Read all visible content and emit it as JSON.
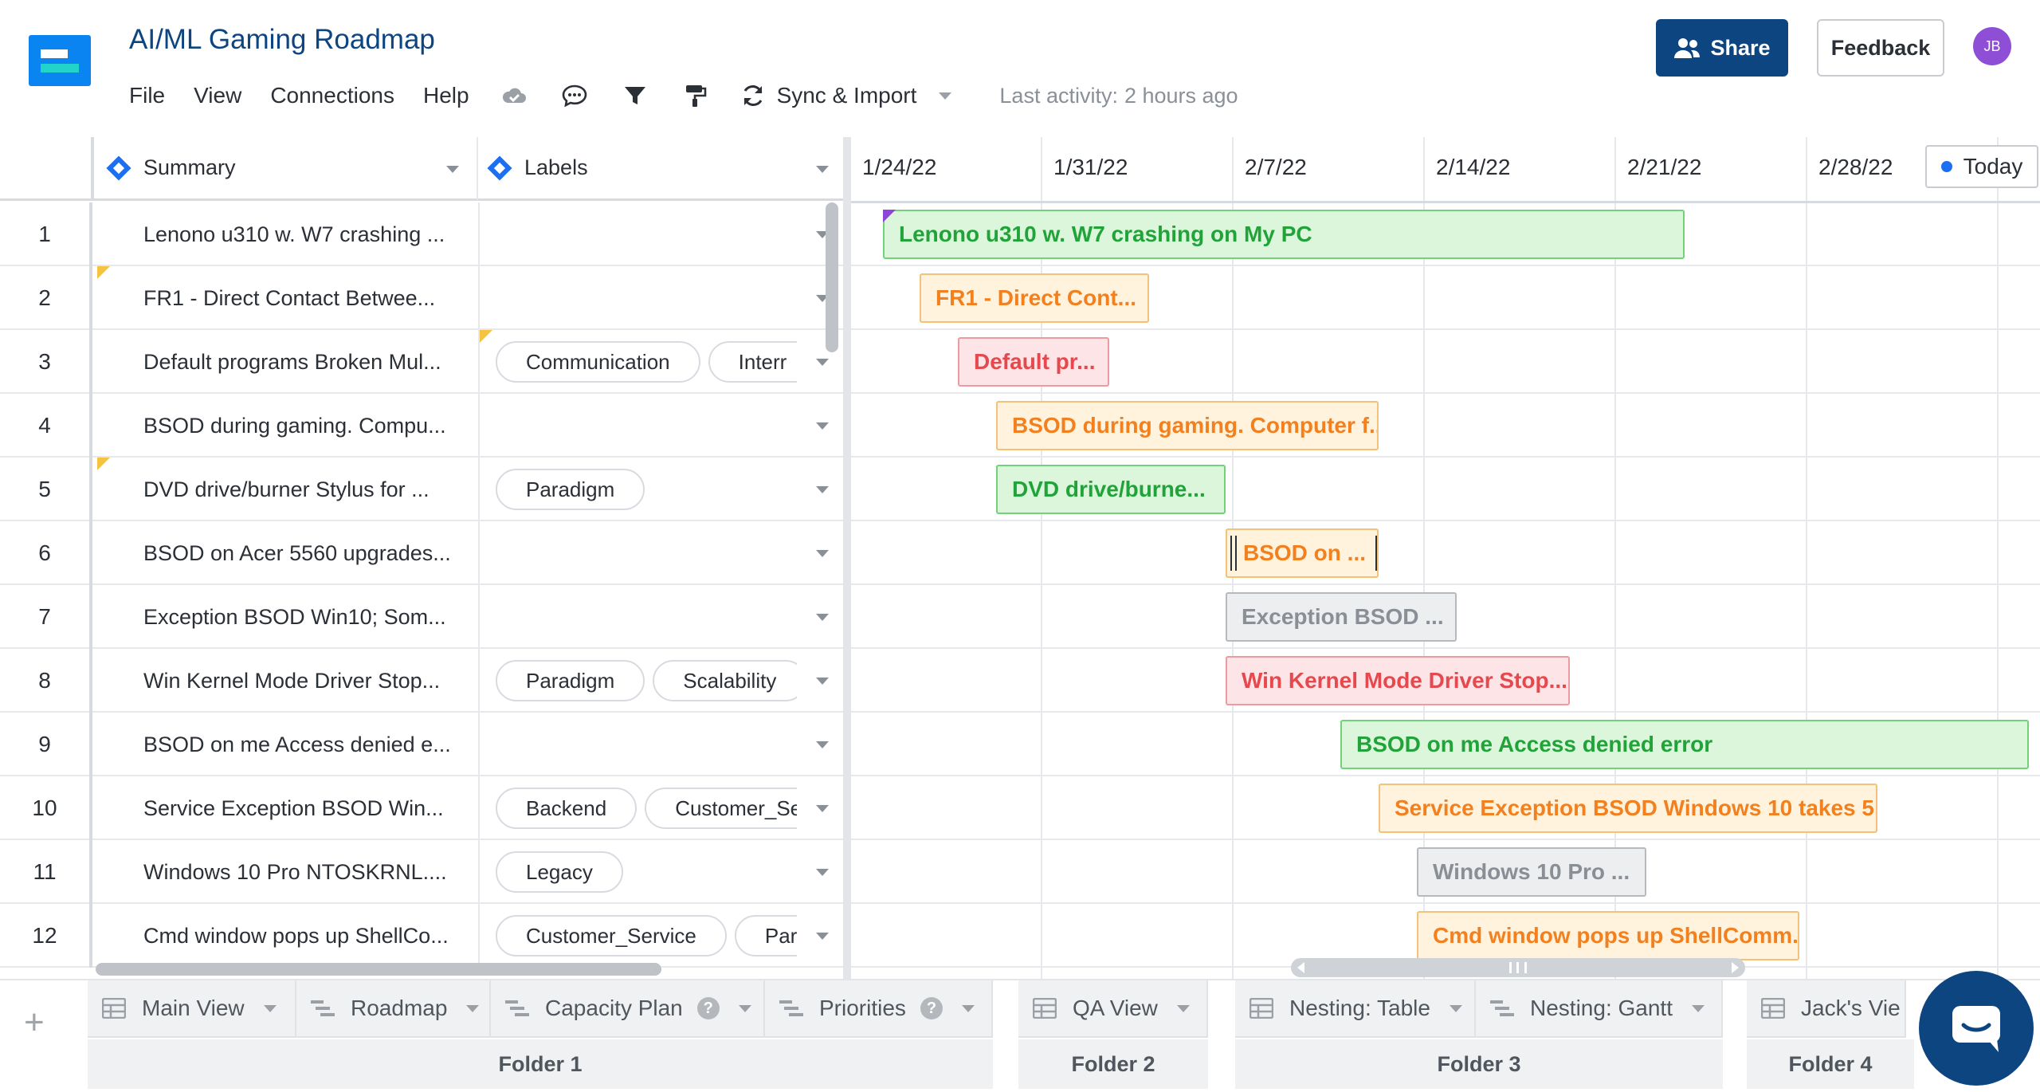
{
  "app": {
    "title": "AI/ML Gaming Roadmap",
    "menu": [
      "File",
      "View",
      "Connections",
      "Help"
    ],
    "sync_label": "Sync & Import",
    "last_activity_label": "Last activity:",
    "last_activity_value": "2 hours ago",
    "share_label": "Share",
    "feedback_label": "Feedback",
    "avatar_initials": "JB"
  },
  "grid": {
    "columns": {
      "summary": "Summary",
      "labels": "Labels"
    },
    "rows": [
      {
        "num": "1",
        "summary": "Lenono u310 w. W7 crashing ...",
        "labels": []
      },
      {
        "num": "2",
        "summary": "FR1 - Direct Contact Betwee...",
        "labels": []
      },
      {
        "num": "3",
        "summary": "Default programs Broken Mul...",
        "labels": [
          "Communication",
          "Interr"
        ]
      },
      {
        "num": "4",
        "summary": "BSOD during gaming. Compu...",
        "labels": []
      },
      {
        "num": "5",
        "summary": "DVD drive/burner Stylus for ...",
        "labels": [
          "Paradigm"
        ]
      },
      {
        "num": "6",
        "summary": "BSOD on Acer 5560 upgrades...",
        "labels": []
      },
      {
        "num": "7",
        "summary": "Exception BSOD Win10; Som...",
        "labels": []
      },
      {
        "num": "8",
        "summary": "Win Kernel Mode Driver Stop...",
        "labels": [
          "Paradigm",
          "Scalability"
        ]
      },
      {
        "num": "9",
        "summary": "BSOD on me Access denied e...",
        "labels": []
      },
      {
        "num": "10",
        "summary": "Service Exception BSOD Win...",
        "labels": [
          "Backend",
          "Customer_Se"
        ]
      },
      {
        "num": "11",
        "summary": "Windows 10 Pro NTOSKRNL....",
        "labels": [
          "Legacy"
        ]
      },
      {
        "num": "12",
        "summary": "Cmd window pops up ShellCo...",
        "labels": [
          "Customer_Service",
          "Par"
        ]
      }
    ]
  },
  "gantt": {
    "weeks": [
      "1/24/22",
      "1/31/22",
      "2/7/22",
      "2/14/22",
      "2/21/22",
      "2/28/22"
    ],
    "today_label": "Today",
    "bars": [
      {
        "row": 1,
        "label": "Lenono u310 w. W7 crashing on My PC",
        "color": "green"
      },
      {
        "row": 2,
        "label": "FR1 - Direct Cont...",
        "color": "orange"
      },
      {
        "row": 3,
        "label": "Default pr...",
        "color": "red"
      },
      {
        "row": 4,
        "label": "BSOD during gaming. Computer f...",
        "color": "orange"
      },
      {
        "row": 5,
        "label": "DVD drive/burne...",
        "color": "green"
      },
      {
        "row": 6,
        "label": "BSOD on ...",
        "color": "orange"
      },
      {
        "row": 7,
        "label": "Exception BSOD ...",
        "color": "gray"
      },
      {
        "row": 8,
        "label": "Win Kernel Mode Driver Stop...",
        "color": "red"
      },
      {
        "row": 9,
        "label": "BSOD on me Access denied error",
        "color": "green"
      },
      {
        "row": 10,
        "label": "Service Exception BSOD Windows 10 takes 5...",
        "color": "orange"
      },
      {
        "row": 11,
        "label": "Windows 10 Pro ...",
        "color": "gray"
      },
      {
        "row": 12,
        "label": "Cmd window pops up ShellComm...",
        "color": "orange"
      }
    ]
  },
  "tabs": [
    {
      "label": "Main View",
      "icon": "table-icon"
    },
    {
      "label": "Roadmap",
      "icon": "gantt-icon"
    },
    {
      "label": "Capacity Plan",
      "icon": "gantt-icon",
      "help": "?"
    },
    {
      "label": "Priorities",
      "icon": "gantt-icon",
      "help": "?"
    },
    {
      "label": "QA View",
      "icon": "table-icon"
    },
    {
      "label": "Nesting: Table",
      "icon": "table-icon"
    },
    {
      "label": "Nesting: Gantt",
      "icon": "gantt-icon"
    },
    {
      "label": "Jack's Vie",
      "icon": "table-icon"
    }
  ],
  "folders": [
    "Folder 1",
    "Folder 2",
    "Folder 3",
    "Folder 4"
  ],
  "add_tab_label": "+",
  "colors": {
    "brand_navy": "#0d4580",
    "brand_blue": "#0a84f0",
    "bar_green": "#22a33a",
    "bar_orange": "#f2801e",
    "bar_red": "#e5484d",
    "bar_gray": "#8a8f96"
  }
}
